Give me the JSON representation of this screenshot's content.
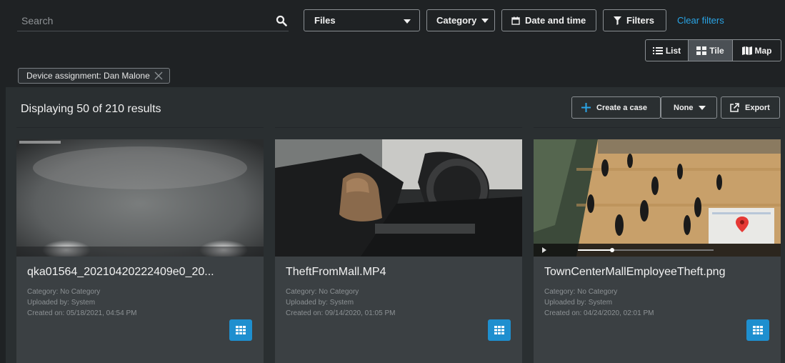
{
  "search": {
    "placeholder": "Search",
    "icon": "search-icon"
  },
  "filters": {
    "files_label": "Files",
    "category_label": "Category",
    "date_label": "Date and time",
    "filters_label": "Filters",
    "clear_label": "Clear filters"
  },
  "view_toggle": {
    "list_label": "List",
    "tile_label": "Tile",
    "map_label": "Map",
    "selected": "Tile"
  },
  "chip": {
    "label": "Device assignment: Dan Malone"
  },
  "results": {
    "title": "Displaying 50 of 210 results",
    "create_case_label": "Create a case",
    "none_label": "None",
    "export_label": "Export"
  },
  "cards": [
    {
      "title": "qka01564_20210420222409e0_20...",
      "category": "Category: No Category",
      "uploaded": "Uploaded by: System",
      "created": "Created on: 05/18/2021, 04:54 PM"
    },
    {
      "title": "TheftFromMall.MP4",
      "category": "Category: No Category",
      "uploaded": "Uploaded by: System",
      "created": "Created on: 09/14/2020, 01:05 PM"
    },
    {
      "title": "TownCenterMallEmployeeTheft.png",
      "category": "Category: No Category",
      "uploaded": "Uploaded by: System",
      "created": "Created on: 04/24/2020, 02:01 PM"
    }
  ],
  "colors": {
    "background": "#1f2224",
    "panel": "#2a2f31",
    "card": "#3b4043",
    "accent": "#1e8fcf",
    "link": "#2aa5e6"
  }
}
